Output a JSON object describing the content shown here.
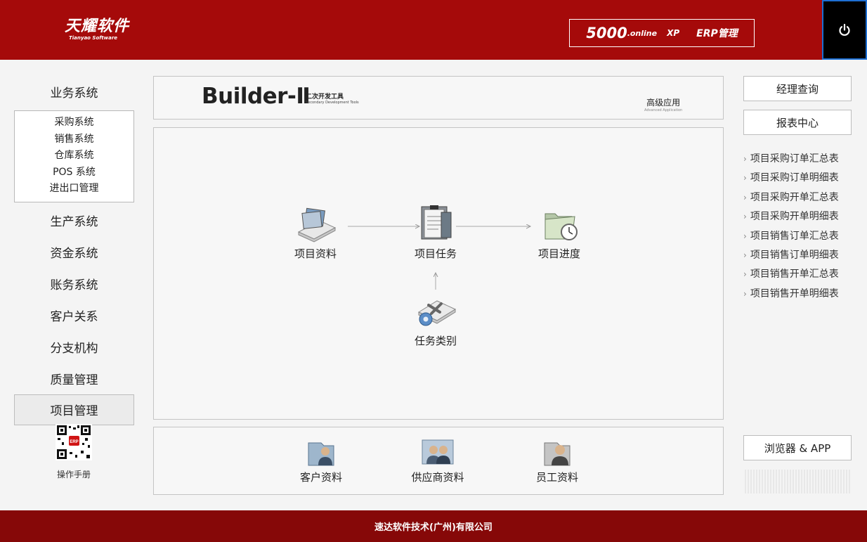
{
  "header": {
    "logo_cn": "天耀软件",
    "logo_en": "Tianyao Software",
    "product_number": "5000",
    "product_online": ".online",
    "product_xp": "XP",
    "product_erp": "ERP管理",
    "power_icon": "power-icon"
  },
  "left_nav": {
    "business": "业务系统",
    "sub_items": [
      "采购系统",
      "销售系统",
      "仓库系统",
      "POS 系统",
      "进出口管理"
    ],
    "production": "生产系统",
    "finance": "资金系统",
    "accounting": "账务系统",
    "customer": "客户关系",
    "branch": "分支机构",
    "quality": "质量管理",
    "project": "项目管理",
    "manual": "操作手册"
  },
  "banner": {
    "builder": "Builder-Ⅱ",
    "sub_cn": "二次开发工具",
    "sub_en": "Secondary Development Tools",
    "advanced_cn": "高级应用",
    "advanced_en": "Advanced Application"
  },
  "flow": {
    "project_data": "项目资料",
    "project_task": "项目任务",
    "project_progress": "项目进度",
    "task_type": "任务类别"
  },
  "bottom": {
    "customer_data": "客户资料",
    "supplier_data": "供应商资料",
    "employee_data": "员工资料"
  },
  "right": {
    "manager_query": "经理查询",
    "report_center": "报表中心",
    "reports": [
      "项目采购订单汇总表",
      "项目采购订单明细表",
      "项目采购开单汇总表",
      "项目采购开单明细表",
      "项目销售订单汇总表",
      "项目销售订单明细表",
      "项目销售开单汇总表",
      "项目销售开单明细表"
    ],
    "browser_app": "浏览器 & APP"
  },
  "footer": {
    "company": "速达软件技术(广州)有限公司"
  },
  "colors": {
    "header_red": "#a50a0a",
    "footer_red": "#860808",
    "power_border": "#1d6fd3"
  }
}
